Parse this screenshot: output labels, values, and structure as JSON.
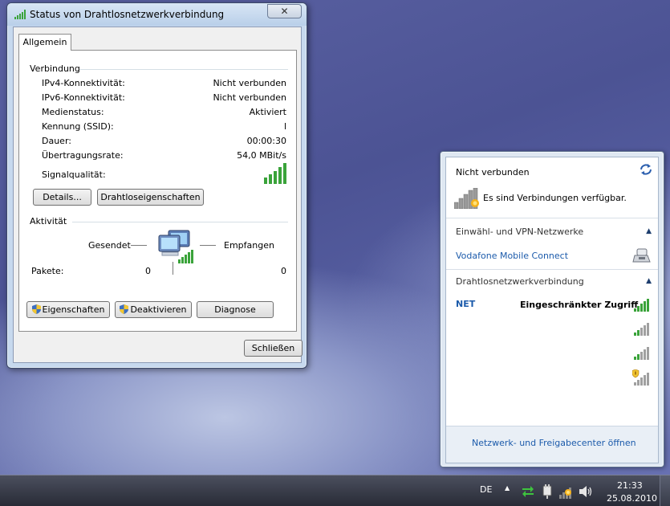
{
  "dialog": {
    "title": "Status von Drahtlosnetzwerkverbindung",
    "close_label": "✕",
    "tab_label": "Allgemein",
    "connection_group": "Verbindung",
    "rows": [
      {
        "label": "IPv4-Konnektivität:",
        "value": "Nicht verbunden"
      },
      {
        "label": "IPv6-Konnektivität:",
        "value": "Nicht verbunden"
      },
      {
        "label": "Medienstatus:",
        "value": "Aktiviert"
      },
      {
        "label": "Kennung (SSID):",
        "value": "l"
      },
      {
        "label": "Dauer:",
        "value": "00:00:30"
      },
      {
        "label": "Übertragungsrate:",
        "value": "54,0 MBit/s"
      }
    ],
    "signal_label": "Signalqualität:",
    "details_button": "Details...",
    "wireless_props_button": "Drahtloseigenschaften",
    "activity_group": "Aktivität",
    "sent_label": "Gesendet",
    "received_label": "Empfangen",
    "packets_label": "Pakete:",
    "packets_sent": "0",
    "packets_received": "0",
    "properties_button": "Eigenschaften",
    "deactivate_button": "Deaktivieren",
    "diagnose_button": "Diagnose",
    "close_button": "Schließen"
  },
  "flyout": {
    "status": "Nicht verbunden",
    "available": "Es sind Verbindungen verfügbar.",
    "dialup_section": "Einwähl- und VPN-Netzwerke",
    "vodafone": "Vodafone Mobile Connect",
    "wireless_section": "Drahtlosnetzwerkverbindung",
    "network1_name": "NET",
    "network1_status": "Eingeschränkter Zugriff",
    "footer_link": "Netzwerk- und Freigabecenter öffnen"
  },
  "taskbar": {
    "language": "DE",
    "time": "21:33",
    "date": "25.08.2010"
  },
  "colors": {
    "signal_green": "#3aa33a",
    "signal_gray": "#a0a0a0",
    "link_blue": "#1c5bab"
  }
}
